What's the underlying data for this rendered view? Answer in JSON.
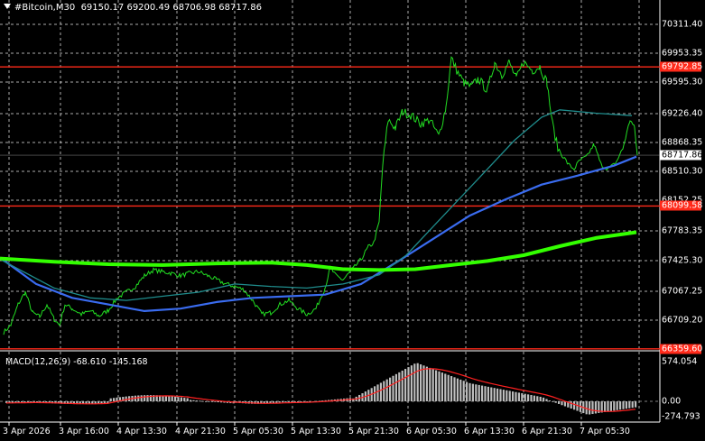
{
  "header": {
    "symbol": "#Bitcoin,M30",
    "ohlc": "69150.17 69200.49 68706.98 68717.86"
  },
  "price_axis": {
    "ticks": [
      "70311.40",
      "69953.35",
      "69595.30",
      "69226.40",
      "68868.35",
      "68510.30",
      "68152.25",
      "67783.35",
      "67425.30",
      "67067.25",
      "66709.20"
    ],
    "current_price": "68717.86",
    "levels": [
      {
        "label": "69792.85",
        "color": "#ff2a1a"
      },
      {
        "label": "68099.58",
        "color": "#ff2a1a"
      },
      {
        "label": "66359.60",
        "color": "#ff2a1a"
      }
    ]
  },
  "time_axis": {
    "labels": [
      "3 Apr 2026",
      "3 Apr 16:00",
      "4 Apr 13:30",
      "4 Apr 21:30",
      "5 Apr 05:30",
      "5 Apr 13:30",
      "5 Apr 21:30",
      "6 Apr 05:30",
      "6 Apr 13:30",
      "6 Apr 21:30",
      "7 Apr 05:30"
    ]
  },
  "macd": {
    "label": "MACD(12,26,9) -68.610 -145.168",
    "ticks": [
      "574.054",
      "0.00",
      "-274.793"
    ]
  },
  "colors": {
    "background": "#000000",
    "grid": "#d8d8d8",
    "price_line": "#22dd22",
    "ma_fast": "#1f8c8c",
    "ma_mid": "#3a6cf0",
    "ma_slow": "#33ff00",
    "level": "#ff2a1a",
    "histogram": "#bdbdbd",
    "signal": "#ff2020"
  }
}
